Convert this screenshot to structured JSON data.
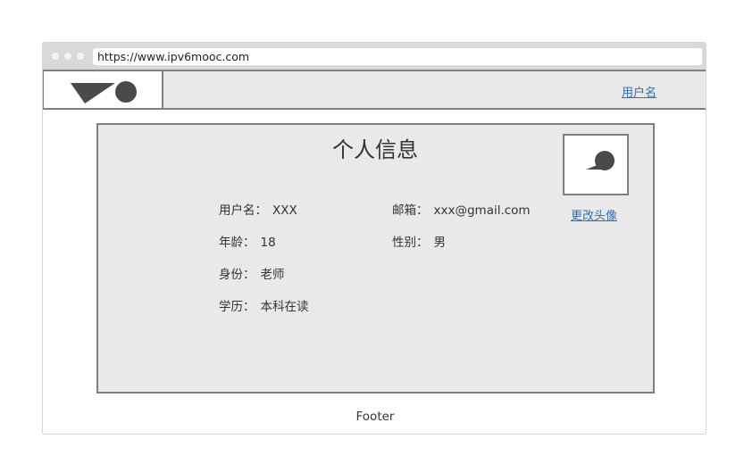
{
  "browser": {
    "url": "https://www.ipv6mooc.com"
  },
  "header": {
    "logo_icon": "logo-shape-icon",
    "username_link": "用户名"
  },
  "profile": {
    "title": "个人信息",
    "fields": {
      "username": {
        "label": "用户名：",
        "value": "XXX"
      },
      "email": {
        "label": "邮箱：",
        "value": "xxx@gmail.com"
      },
      "age": {
        "label": "年龄：",
        "value": "18"
      },
      "gender": {
        "label": "性别：",
        "value": "男"
      },
      "role": {
        "label": "身份：",
        "value": "老师"
      },
      "education": {
        "label": "学历：",
        "value": "本科在读"
      }
    },
    "avatar_icon": "avatar-placeholder-icon",
    "change_avatar_link": "更改头像"
  },
  "footer": {
    "text": "Footer"
  },
  "colors": {
    "panel_bg": "#e9e9e9",
    "border": "#7f7f7f",
    "link": "#2e6fb5",
    "icon": "#4a4a4a"
  }
}
